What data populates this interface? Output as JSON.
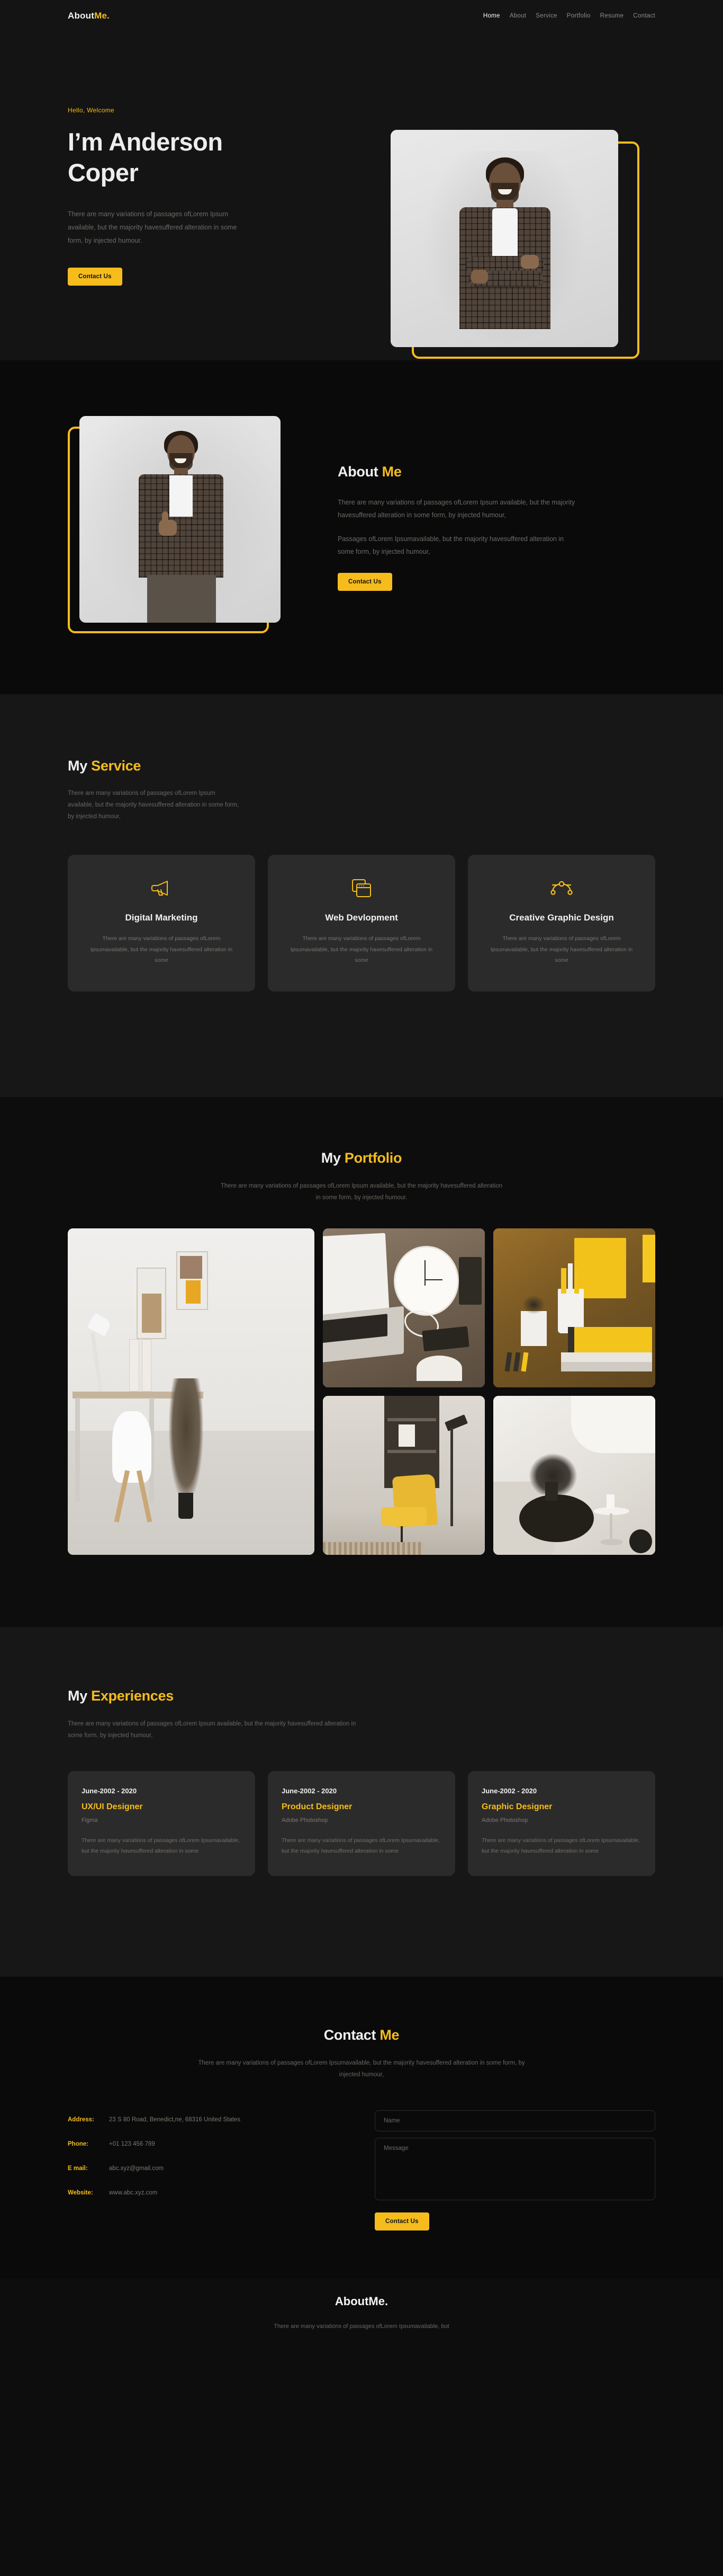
{
  "nav": {
    "logo_main": "About",
    "logo_accent": "Me.",
    "links": [
      {
        "label": "Home",
        "active": true
      },
      {
        "label": "About",
        "active": false
      },
      {
        "label": "Service",
        "active": false
      },
      {
        "label": "Portfolio",
        "active": false
      },
      {
        "label": "Resume",
        "active": false
      },
      {
        "label": "Contact",
        "active": false
      }
    ]
  },
  "hero": {
    "greeting": "Hello, Welcome",
    "title_line1": "I’m Anderson",
    "title_line2": "Coper",
    "description": "There are many variations of passages ofLorem Ipsum available, but the majority havesuffered alteration in some form, by injected humour.",
    "cta_label": "Contact Us",
    "photo_alt": "portrait-man-plaid-shirt-arms-crossed"
  },
  "about": {
    "title_main": "About ",
    "title_accent": "Me",
    "paragraph1": "There are many variations of passages ofLorem Ipsum available, but the majority havesuffered alteration in some form, by injected humour,",
    "paragraph2": "Passages ofLorem Ipsumavailable, but the majority havesuffered alteration in some form, by injected humour,",
    "cta_label": "Contact Us",
    "photo_alt": "portrait-man-plaid-shirt-thumbs-up"
  },
  "service": {
    "title_main": "My ",
    "title_accent": "Service",
    "description": "There are many variations of passages ofLorem Ipsum available, but the majority havesuffered alteration in some form, by injected humour,",
    "cards": [
      {
        "icon": "megaphone-icon",
        "title": "Digital Marketing",
        "description": "There are many variations of passages ofLorem Ipsumavailable, but the majority havesuffered alteration in some"
      },
      {
        "icon": "browser-windows-icon",
        "title": "Web Devlopment",
        "description": "There are many variations of passages ofLorem Ipsumavailable, but the majority havesuffered alteration in some"
      },
      {
        "icon": "pen-tool-icon",
        "title": "Creative Graphic Design",
        "description": "There are many variations of passages ofLorem Ipsumavailable, but the majority havesuffered alteration in some"
      }
    ]
  },
  "portfolio": {
    "title_main": "My ",
    "title_accent": "Portfolio",
    "description": "There are many variations of passages ofLorem Ipsum available, but the majority havesuffered alteration in some form, by injected humour.",
    "tiles": [
      {
        "alt": "white-desk-lamp-chair-plant-workspace"
      },
      {
        "alt": "laptop-wall-clock-headphones-desk"
      },
      {
        "alt": "yellow-stationery-pencils-notebook"
      },
      {
        "alt": "yellow-armchair-shelf-floor-lamp"
      },
      {
        "alt": "coffee-table-plant-living-room"
      }
    ]
  },
  "experiences": {
    "title_main": "My ",
    "title_accent": "Experiences",
    "description": "There are many variations of passages ofLorem Ipsum available, but the majority havesuffered alteration in some form, by injected humour,",
    "cards": [
      {
        "date": "June-2002 - 2020",
        "role": "UX/UI Designer",
        "tool": "Figma",
        "description": "There are many variations of passages ofLorem Ipsumavailable, but the majority havesuffered alteration in some"
      },
      {
        "date": "June-2002 - 2020",
        "role": "Product Designer",
        "tool": "Adobe Photoshop",
        "description": "There are many variations of passages ofLorem Ipsumavailable, but the majority havesuffered alteration in some"
      },
      {
        "date": "June-2002 - 2020",
        "role": "Graphic Designer",
        "tool": "Adobe Photoshop",
        "description": "There are many variations of passages ofLorem Ipsumavailable, but the majority havesuffered alteration in some"
      }
    ]
  },
  "contact": {
    "title_main": "Contact ",
    "title_accent": "Me",
    "description": "There are many variations of passages ofLorem Ipsumavailable, but the majority havesuffered alteration in some form, by injected humour,",
    "info": [
      {
        "label": "Address:",
        "value": "23 S 80 Road, Benedict,ne, 68316 United States"
      },
      {
        "label": "Phone:",
        "value": "+01 123 456 789"
      },
      {
        "label": "E mail:",
        "value": "abc.xyz@gmail.com"
      },
      {
        "label": "Website:",
        "value": "www.abc.xyz.com"
      }
    ],
    "form": {
      "name_placeholder": "Name",
      "name_value": "",
      "message_placeholder": "Message",
      "message_value": "",
      "submit_label": "Contact Us"
    }
  },
  "footer": {
    "logo": "AboutMe.",
    "description": "There are many variations of passages ofLorem Ipsumavailable, but"
  },
  "colors": {
    "accent": "#f5bc1c",
    "bg_dark": "#0a0a0a",
    "bg_panel": "#171717",
    "bg_card": "#2b2b2b"
  }
}
